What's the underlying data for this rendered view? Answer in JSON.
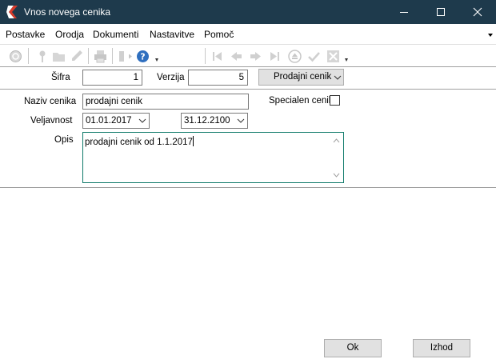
{
  "window": {
    "title": "Vnos novega cenika",
    "icons": [
      "app-logo-icon",
      "minimize-icon",
      "maximize-icon",
      "close-icon"
    ]
  },
  "menu": {
    "items": [
      "Postavke",
      "Orodja",
      "Dokumenti",
      "Nastavitve",
      "Pomoč"
    ]
  },
  "toolbar": {
    "icons": [
      "refresh-icon",
      "pin-icon",
      "folder-icon",
      "edit-icon",
      "print-icon",
      "export-icon",
      "help-icon",
      "first-record-icon",
      "previous-record-icon",
      "next-record-icon",
      "last-record-icon",
      "eject-icon",
      "confirm-icon",
      "delete-icon"
    ]
  },
  "header": {
    "sifra_label": "Šifra",
    "sifra_value": "1",
    "verzija_label": "Verzija",
    "verzija_value": "5",
    "type_combo": "Prodajni cenik"
  },
  "form": {
    "naziv_label": "Naziv cenika",
    "naziv_value": "prodajni cenik",
    "specialen_label": "Specialen cenik",
    "specialen_checked": false,
    "veljavnost_label": "Veljavnost",
    "date_from": "01.01.2017",
    "date_to": "31.12.2100",
    "opis_label": "Opis",
    "opis_value": "prodajni cenik od 1.1.2017"
  },
  "buttons": {
    "ok": "Ok",
    "exit": "Izhod"
  },
  "colors": {
    "titlebar": "#1e3a4c",
    "memo_border": "#0f7a6a",
    "button_face": "#e1e1e1"
  }
}
